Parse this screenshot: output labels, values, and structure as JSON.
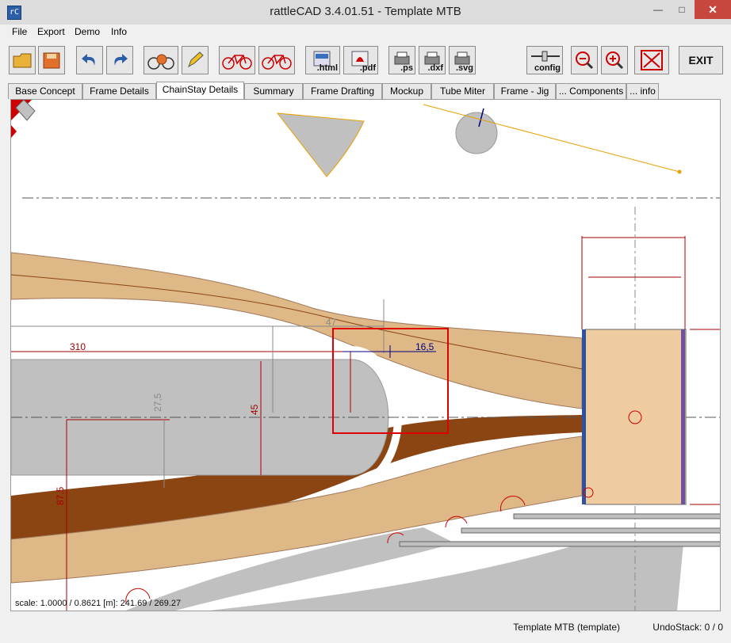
{
  "window": {
    "title": "rattleCAD  3.4.01.51 - Template MTB"
  },
  "menu": {
    "items": [
      "File",
      "Export",
      "Demo",
      "Info"
    ]
  },
  "toolbar": {
    "html_label": ".html",
    "pdf_label": ".pdf",
    "ps_label": ".ps",
    "dxf_label": ".dxf",
    "svg_label": ".svg",
    "config_label": "config",
    "exit_label": "EXIT"
  },
  "tabs": [
    "Base Concept",
    "Frame Details",
    "ChainStay Details",
    "Summary",
    "Frame Drafting",
    "Mockup",
    "Tube Miter",
    "Frame - Jig",
    "... Components",
    "... info"
  ],
  "canvas": {
    "scale_text": "scale: 1.0000 / 0.8621  [m]: 241.69 / 269.27",
    "dimensions": {
      "d310": "310",
      "d47": "47",
      "d16_5": "16,5",
      "d27_5": "27,5",
      "d45": "45",
      "d87_5": "87,5"
    }
  },
  "status": {
    "template": "Template MTB (template)",
    "undo": "UndoStack:  0 /  0"
  },
  "colors": {
    "tube_tan": "#deb887",
    "chainstay_brown": "#8b4513",
    "block_tan": "#efcca0",
    "gray": "#c0c0c0",
    "dim_red": "#a40000",
    "dim_blue": "#000080",
    "highlight_red": "#e00000"
  }
}
